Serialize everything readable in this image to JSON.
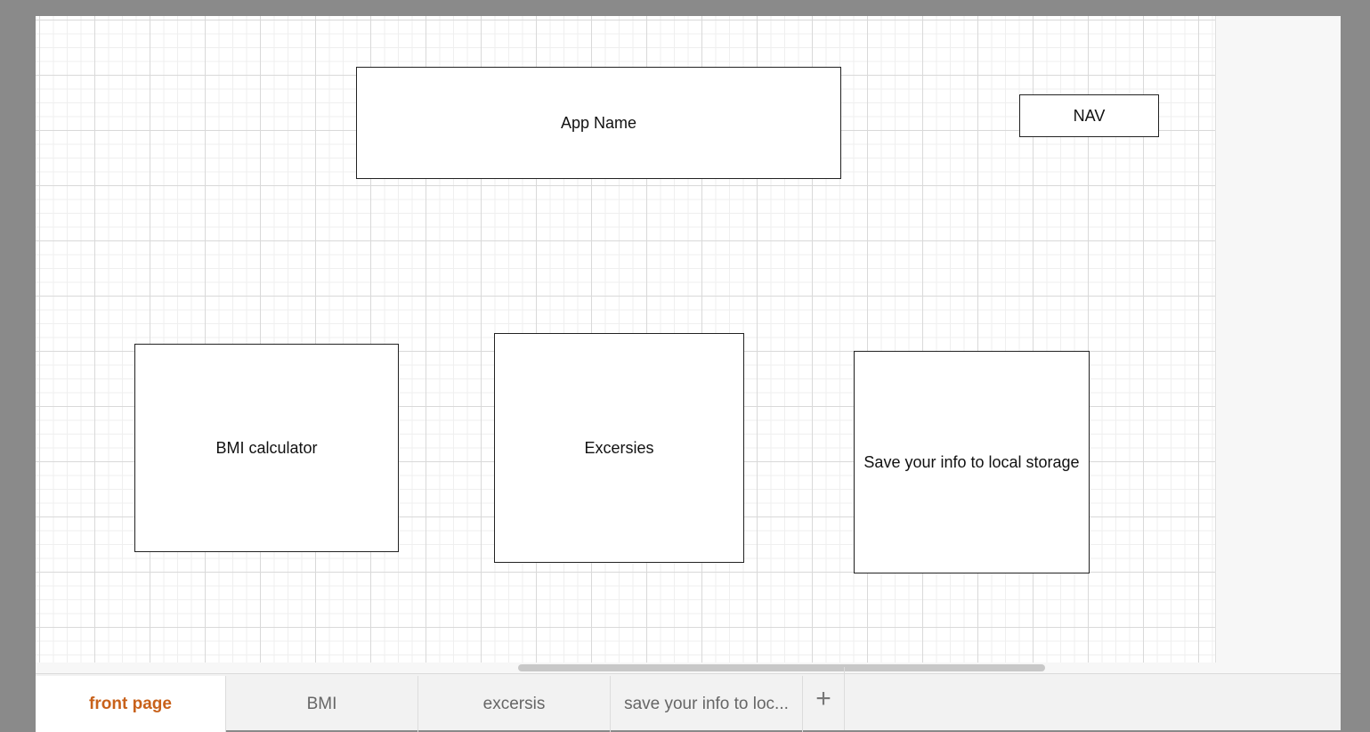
{
  "diagram": {
    "shapes": {
      "app_name": "App Name",
      "nav": "NAV",
      "bmi_calculator": "BMI calculator",
      "exercises": "Excersies",
      "save_info": "Save your info to local storage"
    }
  },
  "tabs": [
    {
      "label": "front page",
      "active": true
    },
    {
      "label": "BMI",
      "active": false
    },
    {
      "label": "excersis",
      "active": false
    },
    {
      "label": "save your info to loc...",
      "active": false
    }
  ],
  "add_tab_icon": "plus-icon",
  "add_tab_glyph": "+"
}
